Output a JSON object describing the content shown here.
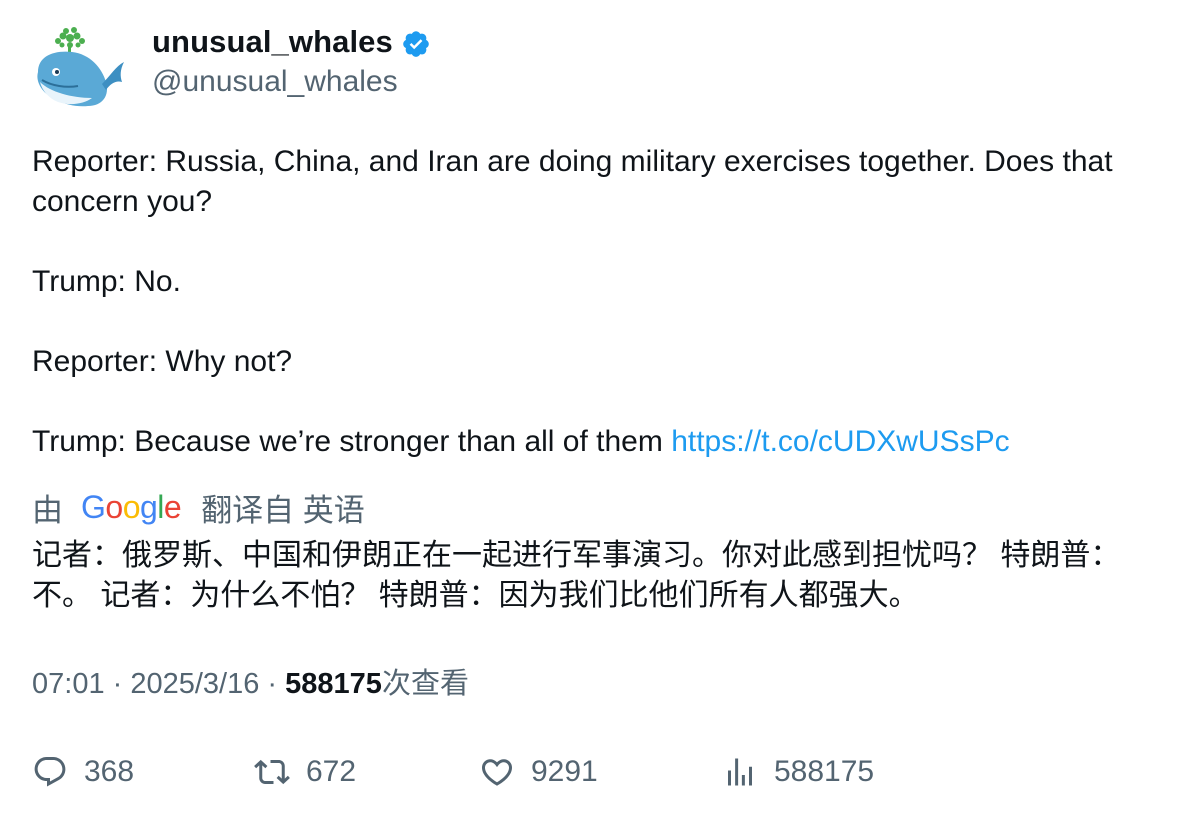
{
  "author": {
    "display_name": "unusual_whales",
    "handle": "@unusual_whales",
    "verified": true,
    "avatar_icon": "whale-logo-icon"
  },
  "tweet": {
    "line1": "Reporter: Russia, China, and Iran are doing military exercises together. Does that concern you?",
    "line2": "Trump: No.",
    "line3": "Reporter: Why not?",
    "line4": "Trump: Because we’re stronger than all of them ",
    "link": "https://t.co/cUDXwUSsPc"
  },
  "translation": {
    "prefix": "由",
    "provider": "Google",
    "suffix": "翻译自 英语",
    "text": "记者：俄罗斯、中国和伊朗正在一起进行军事演习。你对此感到担忧吗？ 特朗普：不。 记者：为什么不怕？ 特朗普：因为我们比他们所有人都强大。"
  },
  "meta": {
    "time": "07:01",
    "separator": " · ",
    "date": "2025/3/16",
    "views_count": "588175",
    "views_label": "次查看"
  },
  "actions": {
    "replies": "368",
    "retweets": "672",
    "likes": "9291",
    "views": "588175"
  },
  "colors": {
    "link": "#1d9bf0",
    "muted": "#536471",
    "text": "#0f1419",
    "verified": "#1d9bf0"
  }
}
